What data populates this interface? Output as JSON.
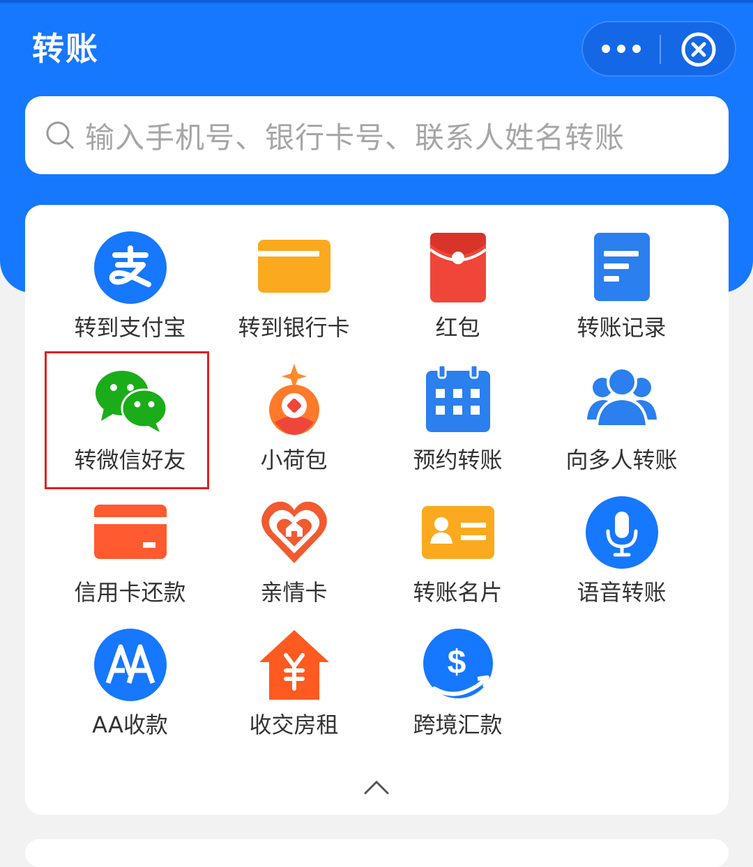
{
  "header": {
    "title": "转账"
  },
  "search": {
    "placeholder": "输入手机号、银行卡号、联系人姓名转账"
  },
  "colors": {
    "primary": "#1677ff",
    "highlight_border": "#e02020"
  },
  "grid": [
    {
      "label": "转到支付宝",
      "icon": "alipay-icon"
    },
    {
      "label": "转到银行卡",
      "icon": "bank-card-icon"
    },
    {
      "label": "红包",
      "icon": "red-packet-icon"
    },
    {
      "label": "转账记录",
      "icon": "record-icon"
    },
    {
      "label": "转微信好友",
      "icon": "wechat-icon"
    },
    {
      "label": "小荷包",
      "icon": "purse-icon"
    },
    {
      "label": "预约转账",
      "icon": "calendar-icon"
    },
    {
      "label": "向多人转账",
      "icon": "group-icon"
    },
    {
      "label": "信用卡还款",
      "icon": "credit-card-icon"
    },
    {
      "label": "亲情卡",
      "icon": "family-heart-icon"
    },
    {
      "label": "转账名片",
      "icon": "business-card-icon"
    },
    {
      "label": "语音转账",
      "icon": "microphone-icon"
    },
    {
      "label": "AA收款",
      "icon": "aa-icon"
    },
    {
      "label": "收交房租",
      "icon": "rent-house-icon"
    },
    {
      "label": "跨境汇款",
      "icon": "cross-border-icon"
    }
  ],
  "collapse": {
    "icon": "chevron-up-icon"
  }
}
